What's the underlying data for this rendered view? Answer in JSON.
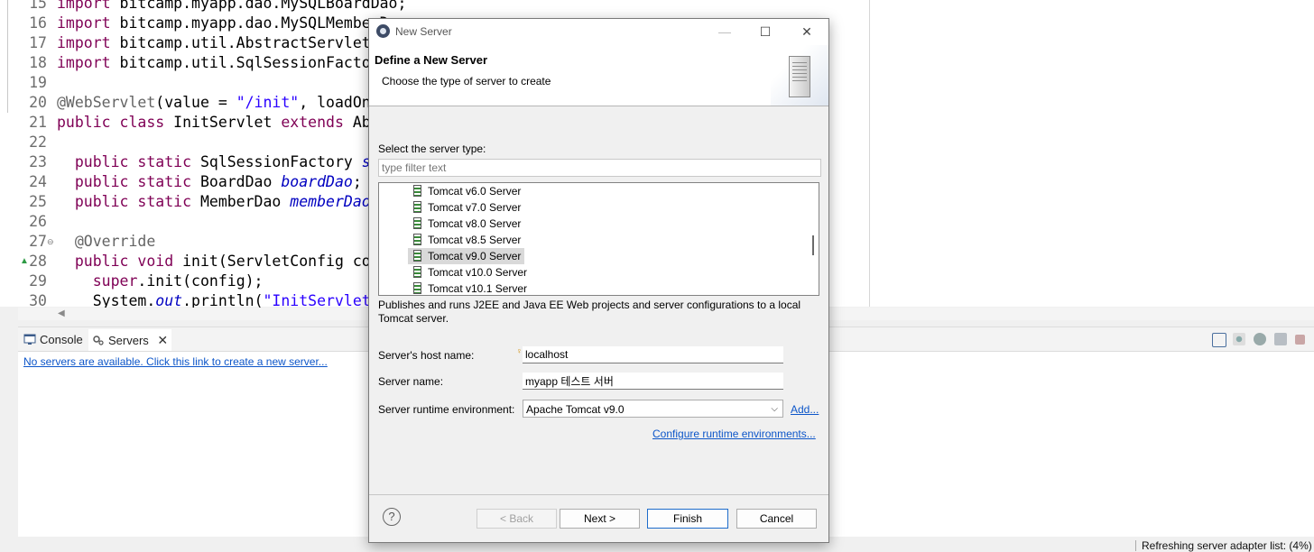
{
  "editor": {
    "lines": [
      {
        "num": "15",
        "text": "import bitcamp.myapp.dao.MySQLBoardDao;"
      },
      {
        "num": "16",
        "text": "import bitcamp.myapp.dao.MySQLMemberDao"
      },
      {
        "num": "17",
        "text": "import bitcamp.util.AbstractServlet;"
      },
      {
        "num": "18",
        "text": "import bitcamp.util.SqlSessionFactoryP"
      },
      {
        "num": "19",
        "text": ""
      },
      {
        "num": "20",
        "text": "@WebServlet(value = \"/init\", loadOnStar"
      },
      {
        "num": "21",
        "text": "public class InitServlet extends Abstra"
      },
      {
        "num": "22",
        "text": ""
      },
      {
        "num": "23",
        "text": "  public static SqlSessionFactory sqlS"
      },
      {
        "num": "24",
        "text": "  public static BoardDao boardDao;"
      },
      {
        "num": "25",
        "text": "  public static MemberDao memberDao;"
      },
      {
        "num": "26",
        "text": ""
      },
      {
        "num": "27",
        "text": "  @Override"
      },
      {
        "num": "28",
        "text": "  public void init(ServletConfig config"
      },
      {
        "num": "29",
        "text": "    super.init(config);"
      },
      {
        "num": "30",
        "text": "    System.out.println(\"InitServlet.in"
      }
    ]
  },
  "panel": {
    "tabs": [
      {
        "label": "Console",
        "icon": "console-icon"
      },
      {
        "label": "Servers",
        "icon": "servers-icon",
        "active": true
      }
    ],
    "empty_link": "No servers are available. Click this link to create a new server..."
  },
  "status": {
    "text": "Refreshing server adapter list: (4%)"
  },
  "dialog": {
    "title": "New Server",
    "banner_title": "Define a New Server",
    "banner_desc": "Choose the type of server to create",
    "type_label": "Select the server type:",
    "filter_placeholder": "type filter text",
    "server_types": [
      "Tomcat v6.0 Server",
      "Tomcat v7.0 Server",
      "Tomcat v8.0 Server",
      "Tomcat v8.5 Server",
      "Tomcat v9.0 Server",
      "Tomcat v10.0 Server",
      "Tomcat v10.1 Server"
    ],
    "selected_type": "Tomcat v9.0 Server",
    "description": "Publishes and runs J2EE and Java EE Web projects and server configurations to a local Tomcat server.",
    "host_label": "Server's host name:",
    "host_value": "localhost",
    "name_label": "Server name:",
    "name_value": "myapp 테스트 서버",
    "runtime_label": "Server runtime environment:",
    "runtime_value": "Apache Tomcat v9.0",
    "add_link": "Add...",
    "configure_link": "Configure runtime environments...",
    "buttons": {
      "back": "< Back",
      "next": "Next >",
      "finish": "Finish",
      "cancel": "Cancel"
    },
    "help": "?"
  }
}
